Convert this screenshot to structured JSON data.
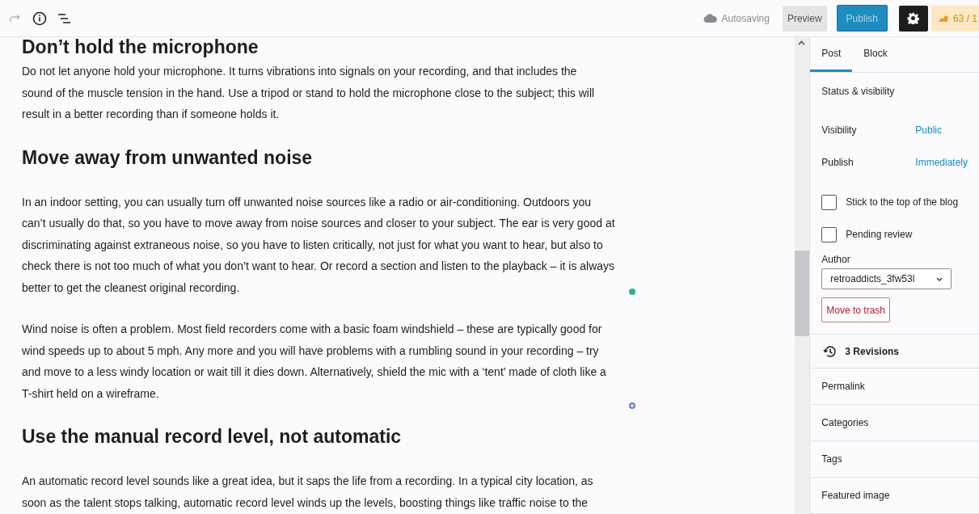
{
  "toolbar": {
    "redo_disabled": true,
    "autosave": "Autosaving",
    "preview": "Preview",
    "publish": "Publish",
    "settings_selected": true,
    "counter": "63 / 1"
  },
  "content": [
    {
      "kind": "heading",
      "lines": [
        "Don’t hold the microphone"
      ]
    },
    {
      "kind": "paragraph",
      "lines": [
        "Do not let anyone hold your microphone. It turns vibrations into signals on your recording, and that includes the",
        "sound of the muscle tension in the hand. Use a tripod or stand to hold the microphone close to the subject; this will",
        "result in a better recording than if someone holds it."
      ]
    },
    {
      "kind": "heading",
      "lines": [
        "Move away from unwanted noise"
      ]
    },
    {
      "kind": "paragraph",
      "status_dot": true,
      "lines": [
        "In an indoor setting, you can usually turn off unwanted noise sources like a radio or air-conditioning. Outdoors you",
        "can’t usually do that, so you have to move away from noise sources and closer to your subject. The ear is very good at",
        "discriminating against extraneous noise, so you have to listen critically, not just for what you want to hear, but also to",
        "check there is not too much of what you don’t want to hear. Or record a section and listen to the playback – it is always",
        "better to get the cleanest original recording."
      ]
    },
    {
      "kind": "paragraph",
      "add_button": true,
      "lines": [
        "Wind noise is often a problem. Most field recorders come with a basic foam windshield – these are typically good for",
        "wind speeds up to about 5 mph. Any more and you will have problems with a rumbling sound in your recording – try",
        "and move to a less windy location or wait till it dies down. Alternatively, shield the mic with a ‘tent’ made of cloth like a",
        "T-shirt held on a wireframe."
      ]
    },
    {
      "kind": "heading",
      "lines": [
        "Use the manual record level, not automatic"
      ]
    },
    {
      "kind": "paragraph",
      "lines": [
        "An automatic record level sounds like a great idea, but it saps the life from a recording. In a typical city location, as",
        "soon as the talent stops talking, automatic record level winds up the levels, boosting things like traffic noise to the"
      ]
    }
  ],
  "sidebar": {
    "tabs": [
      {
        "label": "Post",
        "selected": true
      },
      {
        "label": "Block",
        "selected": false
      }
    ],
    "status_title": "Status & visibility",
    "fields": [
      {
        "label": "Visibility",
        "value": "Public"
      },
      {
        "label": "Publish",
        "value": "Immediately"
      }
    ],
    "checkboxes": [
      {
        "label": "Stick to the top of the blog",
        "checked": false
      },
      {
        "label": "Pending review",
        "checked": false
      }
    ],
    "author_label": "Author",
    "author": "retroaddicts_3fw53l",
    "trash": "Move to trash",
    "revisions": "3 Revisions",
    "panels": [
      "Permalink",
      "Categories",
      "Tags",
      "Featured image"
    ]
  }
}
